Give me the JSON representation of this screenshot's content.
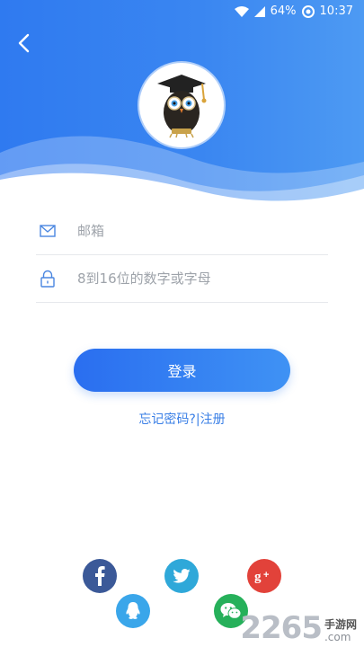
{
  "status": {
    "battery": "64%",
    "time": "10:37"
  },
  "form": {
    "email_placeholder": "邮箱",
    "password_placeholder": "8到16位的数字或字母",
    "login_label": "登录"
  },
  "links": {
    "forgot": "忘记密码?",
    "separator": "|",
    "register": "注册"
  },
  "social": [
    "facebook-icon",
    "twitter-icon",
    "google-plus-icon",
    "qq-icon",
    "wechat-icon"
  ],
  "colors": {
    "primary": "#2f7af0",
    "link": "#3a7fe6",
    "facebook": "#3b5998",
    "twitter": "#2fa8d9",
    "google": "#e2423a",
    "qq": "#3aa6ea",
    "wechat": "#26b05a"
  },
  "watermark": {
    "number": "2265",
    "suffix_top": "手游网",
    "suffix_bottom": ".com"
  }
}
